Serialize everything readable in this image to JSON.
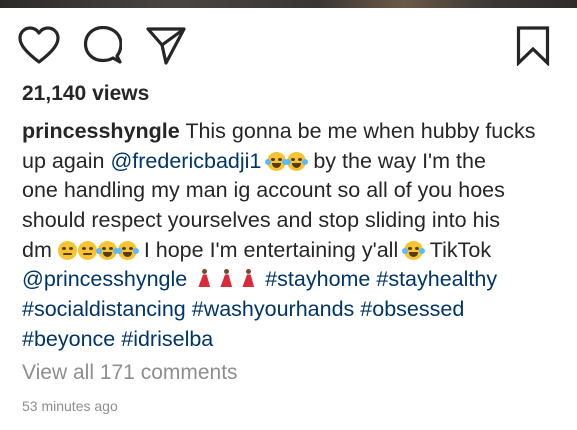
{
  "post": {
    "views": "21,140 views",
    "caption": {
      "username": "princesshyngle",
      "line1_text": " This gonna be me when hubby fucks",
      "line2_pre": "up again ",
      "line2_mention": "@fredericbadji1",
      "line2_post": " by the way I'm the",
      "line3": "one handling my man ig account so all of you hoes",
      "line4": "should respect yourselves and stop sliding into his",
      "line5_pre": "dm ",
      "line5_mid": " I hope I'm entertaining y'all ",
      "line5_post": " TikTok",
      "line6_mention": "@princesshyngle",
      "line6_tag1": "#stayhome",
      "line6_tag2": "#stayhealthy",
      "line7_tag1": "#socialdistancing",
      "line7_tag2": "#washyourhands",
      "line7_tag3": "#obsessed",
      "line8_tag1": "#beyonce",
      "line8_tag2": "#idriselba"
    },
    "view_comments": "View all 171 comments",
    "timestamp": "53 minutes ago"
  },
  "icons": {
    "like": "heart-icon",
    "comment": "comment-bubble-icon",
    "share": "paper-plane-icon",
    "save": "bookmark-icon",
    "emoji_laugh": "face-with-tears-of-joy-icon",
    "emoji_roll": "face-with-rolling-eyes-icon",
    "emoji_rofl": "rolling-on-floor-laughing-icon",
    "emoji_dancer": "dancer-icon"
  },
  "colors": {
    "text": "#262626",
    "link": "#003569",
    "muted": "#8e8e8e"
  }
}
